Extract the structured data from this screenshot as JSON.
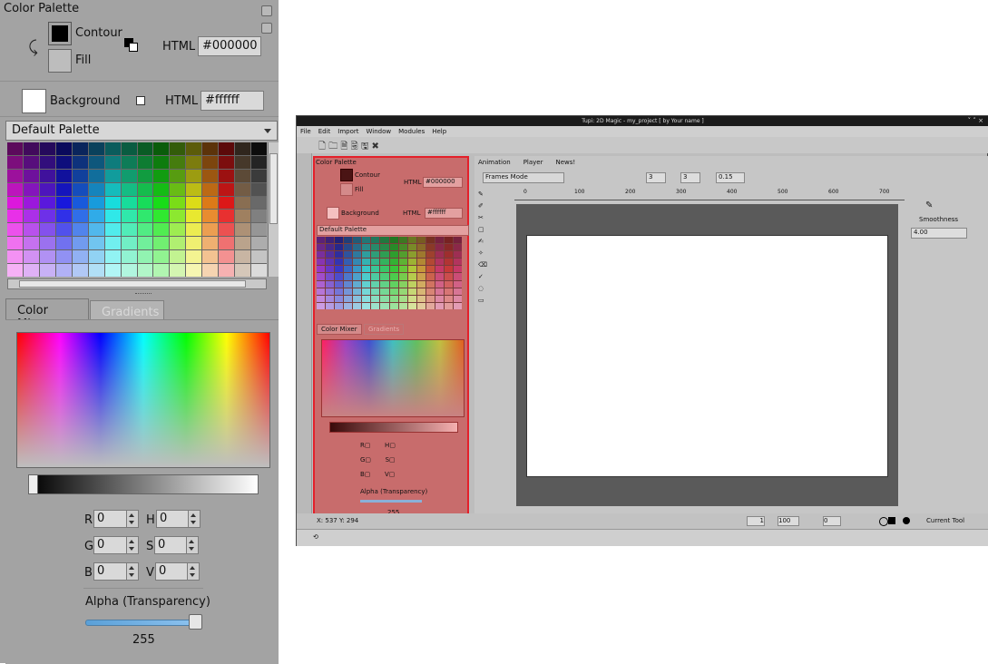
{
  "left_panel": {
    "title": "Color Palette",
    "contour_label": "Contour",
    "fill_label": "Fill",
    "html_label": "HTML",
    "contour_html": "#000000",
    "background_label": "Background",
    "background_html": "#ffffff",
    "palette_select": "Default Palette",
    "tabs": {
      "mixer": "Color Mixer",
      "gradients": "Gradients"
    },
    "rgb": {
      "r_label": "R",
      "g_label": "G",
      "b_label": "B",
      "r": "0",
      "g": "0",
      "b": "0"
    },
    "hsv": {
      "h_label": "H",
      "s_label": "S",
      "v_label": "V",
      "h": "0",
      "s": "0",
      "v": "0"
    },
    "alpha_label": "Alpha (Transparency)",
    "alpha_value": "255",
    "alpha_fraction": 1.0
  },
  "app": {
    "title": "Tupi: 2D Magic - my_project [ by Your name ]",
    "menu": [
      "File",
      "Edit",
      "Import",
      "Window",
      "Modules",
      "Help"
    ],
    "panel_title": "Color Palette",
    "panel_contour": "Contour",
    "panel_fill": "Fill",
    "panel_html": "HTML",
    "panel_contour_html": "#000000",
    "panel_background": "Background",
    "panel_background_html": "#ffffff",
    "panel_palette": "Default Palette",
    "panel_mixer_tab": "Color Mixer",
    "panel_gradients_tab": "Gradients",
    "panel_alpha": "Alpha (Transparency)",
    "panel_alpha_value": "255",
    "tabs": [
      "Animation",
      "Player",
      "News!"
    ],
    "frames_mode": "Frames Mode",
    "spin_a": "3",
    "spin_b": "3",
    "spin_c": "0.15",
    "ruler": [
      "0",
      "100",
      "200",
      "300",
      "400",
      "500",
      "600",
      "700"
    ],
    "smoothness_label": "Smoothness",
    "smoothness_value": "4.00",
    "coords": "X: 537 Y: 294",
    "frame_value": "1",
    "zoom_value": "100",
    "rotation_value": "0",
    "current_tool": "Current Tool"
  },
  "colors": {
    "panel_bg": "#a3a3a3",
    "highlight_red": "#e4202a",
    "highlight_fill": "#c86c6c"
  }
}
